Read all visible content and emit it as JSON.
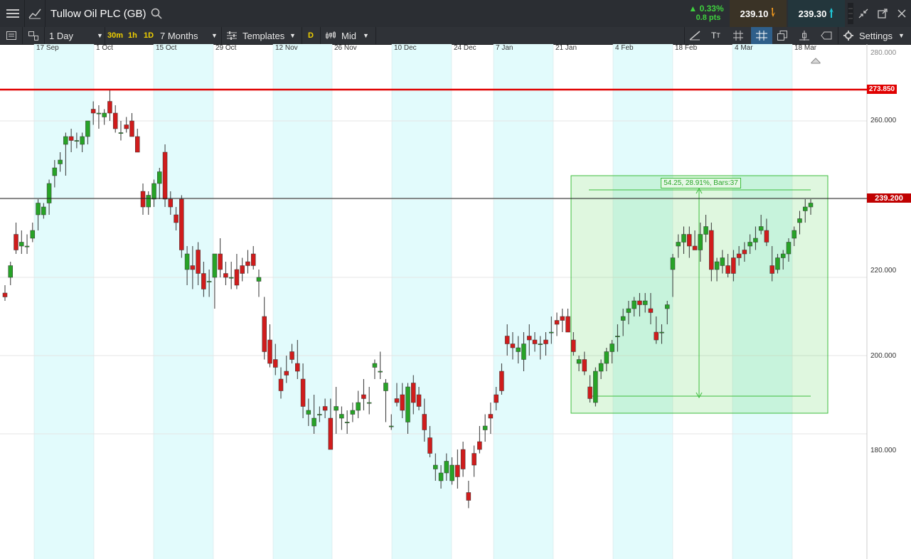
{
  "header": {
    "title": "Tullow Oil PLC (GB)",
    "change_pct": "▲ 0.33%",
    "change_pts": "0.8 pts",
    "sell_price": "239.10",
    "buy_price": "239.30"
  },
  "toolbar": {
    "interval": "1 Day",
    "quick_30m": "30m",
    "quick_1h": "1h",
    "quick_1d": "1D",
    "range": "7 Months",
    "templates": "Templates",
    "d_badge": "D",
    "price_type": "Mid",
    "settings": "Settings"
  },
  "axis": {
    "dates": [
      "17 Sep",
      "1 Oct",
      "15 Oct",
      "29 Oct",
      "12 Nov",
      "26 Nov",
      "10 Dec",
      "24 Dec",
      "7 Jan",
      "21 Jan",
      "4 Feb",
      "18 Feb",
      "4 Mar",
      "18 Mar"
    ],
    "prices": [
      "260.000",
      "220.000",
      "200.000",
      "180.000"
    ],
    "top_price": "280.000"
  },
  "lines": {
    "resistance_label": "273.850",
    "current_label": "239.200",
    "resistance_color": "#e00000",
    "current_color": "#222222"
  },
  "measure": {
    "label": "54.25, 28.91%, Bars:37"
  },
  "chart_data": {
    "type": "candlestick",
    "ylim": [
      163,
      286
    ],
    "resistance": 273.85,
    "current": 239.2,
    "measure": {
      "from": 191.5,
      "to": 238.5,
      "change": 54.25,
      "pct": 28.91,
      "bars": 37
    },
    "ohlc": [
      [
        216,
        218,
        214,
        215
      ],
      [
        220,
        224,
        218,
        223
      ],
      [
        231,
        234,
        226,
        227
      ],
      [
        228,
        232,
        226,
        229
      ],
      [
        228,
        231,
        226,
        228
      ],
      [
        230,
        234,
        229,
        232
      ],
      [
        236,
        240,
        232,
        239
      ],
      [
        236,
        239,
        235,
        238
      ],
      [
        239,
        245,
        236,
        244
      ],
      [
        246,
        250,
        243,
        248
      ],
      [
        249,
        252,
        247,
        250
      ],
      [
        254,
        257,
        246,
        256
      ],
      [
        256,
        258,
        252,
        255
      ],
      [
        255,
        257,
        253,
        255
      ],
      [
        254,
        257,
        252,
        256
      ],
      [
        256,
        260,
        254,
        260
      ],
      [
        263,
        265,
        259,
        262
      ],
      [
        262,
        264,
        258,
        262
      ],
      [
        261,
        263,
        259,
        262
      ],
      [
        265,
        268,
        260,
        262
      ],
      [
        262,
        264,
        257,
        258
      ],
      [
        257,
        260,
        255,
        257
      ],
      [
        259,
        261,
        257,
        258
      ],
      [
        260,
        262,
        256,
        256
      ],
      [
        256,
        258,
        252,
        252
      ],
      [
        242,
        244,
        236,
        238
      ],
      [
        238,
        242,
        236,
        241
      ],
      [
        240,
        245,
        238,
        244
      ],
      [
        244,
        248,
        240,
        247
      ],
      [
        252,
        254,
        238,
        240
      ],
      [
        240,
        242,
        236,
        238
      ],
      [
        236,
        238,
        232,
        234
      ],
      [
        240,
        241,
        225,
        227
      ],
      [
        222,
        228,
        218,
        226
      ],
      [
        223,
        228,
        217,
        222
      ],
      [
        227,
        229,
        218,
        221
      ],
      [
        221,
        224,
        215,
        217
      ],
      [
        219,
        222,
        215,
        219
      ],
      [
        220,
        226,
        212,
        226
      ],
      [
        226,
        230,
        220,
        222
      ],
      [
        221,
        224,
        218,
        220
      ],
      [
        220,
        224,
        217,
        220
      ],
      [
        222,
        226,
        217,
        218
      ],
      [
        223,
        225,
        219,
        221
      ],
      [
        224,
        227,
        221,
        223
      ],
      [
        226,
        228,
        222,
        223
      ],
      [
        219,
        222,
        215,
        220
      ],
      [
        210,
        215,
        199,
        201
      ],
      [
        204,
        208,
        197,
        198
      ],
      [
        199,
        203,
        195,
        197
      ],
      [
        194,
        197,
        189,
        191
      ],
      [
        196,
        200,
        193,
        195
      ],
      [
        201,
        203,
        198,
        199
      ],
      [
        198,
        204,
        194,
        196
      ],
      [
        194,
        198,
        184,
        187
      ],
      [
        185,
        189,
        182,
        186
      ],
      [
        182,
        190,
        180,
        184
      ],
      [
        185,
        187,
        183,
        185
      ],
      [
        187,
        189,
        184,
        186
      ],
      [
        184,
        189,
        176,
        176
      ],
      [
        186,
        192,
        180,
        187
      ],
      [
        184,
        187,
        181,
        185
      ],
      [
        183,
        186,
        180,
        183
      ],
      [
        185,
        188,
        183,
        186
      ],
      [
        186,
        191,
        184,
        188
      ],
      [
        190,
        194,
        186,
        189
      ],
      [
        188,
        192,
        185,
        188
      ],
      [
        197,
        199,
        194,
        198
      ],
      [
        196,
        201,
        194,
        196
      ],
      [
        191,
        194,
        183,
        193
      ],
      [
        182,
        185,
        181,
        182
      ],
      [
        189,
        193,
        187,
        188
      ],
      [
        190,
        193,
        184,
        186
      ],
      [
        183,
        193,
        180,
        192
      ],
      [
        193,
        195,
        185,
        188
      ],
      [
        190,
        192,
        186,
        187
      ],
      [
        185,
        189,
        178,
        181
      ],
      [
        179,
        182,
        174,
        175
      ],
      [
        171,
        175,
        168,
        172
      ],
      [
        168,
        172,
        166,
        170
      ],
      [
        170,
        175,
        168,
        173
      ],
      [
        168,
        174,
        167,
        172
      ],
      [
        172,
        176,
        166,
        169
      ],
      [
        176,
        178,
        169,
        171
      ],
      [
        165,
        168,
        161,
        163
      ],
      [
        175,
        177,
        169,
        172
      ],
      [
        178,
        182,
        175,
        176
      ],
      [
        181,
        185,
        178,
        182
      ],
      [
        185,
        188,
        180,
        184
      ],
      [
        190,
        192,
        186,
        188
      ],
      [
        196,
        198,
        190,
        191
      ],
      [
        205,
        208,
        200,
        203
      ],
      [
        203,
        206,
        199,
        202
      ],
      [
        201,
        205,
        198,
        202
      ],
      [
        199,
        206,
        196,
        203
      ],
      [
        205,
        208,
        200,
        204
      ],
      [
        204,
        206,
        201,
        203
      ],
      [
        203,
        205,
        199,
        203
      ],
      [
        204,
        206,
        200,
        203
      ],
      [
        206,
        210,
        203,
        206
      ],
      [
        209,
        211,
        205,
        208
      ],
      [
        210,
        212,
        206,
        209
      ],
      [
        210,
        212,
        207,
        206
      ],
      [
        204,
        206,
        200,
        201
      ],
      [
        198,
        200,
        196,
        199
      ],
      [
        199,
        201,
        195,
        196
      ],
      [
        192,
        195,
        188,
        189
      ],
      [
        188,
        197,
        187,
        196
      ],
      [
        196,
        199,
        194,
        198
      ],
      [
        198,
        202,
        196,
        201
      ],
      [
        201,
        204,
        198,
        203
      ],
      [
        205,
        208,
        201,
        205
      ],
      [
        209,
        212,
        205,
        210
      ],
      [
        211,
        214,
        208,
        212
      ],
      [
        212,
        215,
        210,
        214
      ],
      [
        214,
        216,
        210,
        213
      ],
      [
        213,
        216,
        211,
        214
      ],
      [
        212,
        216,
        208,
        211
      ],
      [
        206,
        210,
        203,
        204
      ],
      [
        206,
        208,
        203,
        206
      ],
      [
        212,
        214,
        208,
        213
      ],
      [
        222,
        226,
        215,
        225
      ],
      [
        228,
        231,
        225,
        229
      ],
      [
        229,
        233,
        226,
        231
      ],
      [
        231,
        233,
        225,
        228
      ],
      [
        228,
        232,
        227,
        227
      ],
      [
        227,
        234,
        224,
        231
      ],
      [
        231,
        236,
        229,
        233
      ],
      [
        232,
        234,
        219,
        222
      ],
      [
        222,
        225,
        219,
        224
      ],
      [
        223,
        227,
        221,
        225
      ],
      [
        223,
        226,
        220,
        221
      ],
      [
        225,
        227,
        219,
        221
      ],
      [
        226,
        228,
        223,
        225
      ],
      [
        227,
        229,
        224,
        226
      ],
      [
        228,
        231,
        226,
        229
      ],
      [
        229,
        233,
        227,
        230
      ],
      [
        232,
        236,
        231,
        233
      ],
      [
        232,
        235,
        228,
        229
      ],
      [
        223,
        228,
        219,
        221
      ],
      [
        222,
        226,
        221,
        225
      ],
      [
        225,
        227,
        222,
        226
      ],
      [
        226,
        230,
        224,
        229
      ],
      [
        230,
        233,
        228,
        232
      ],
      [
        234,
        237,
        231,
        235
      ],
      [
        237,
        240,
        234,
        238
      ],
      [
        238,
        240,
        236,
        239
      ]
    ]
  }
}
